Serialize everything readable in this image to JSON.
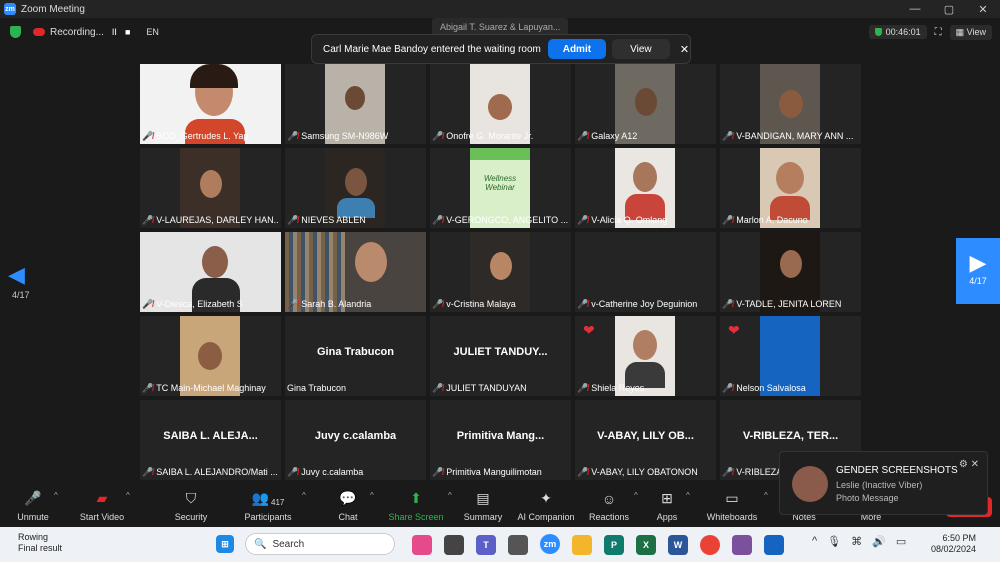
{
  "window": {
    "title": "Zoom Meeting",
    "controls": [
      "—",
      "▢",
      "✕"
    ]
  },
  "topbar": {
    "recording_label": "Recording...",
    "pause_glyph": "II",
    "stop_glyph": "■",
    "language": "EN",
    "timer": "00:46:01",
    "view_label": "View"
  },
  "ghost_name": "Abigail T. Suarez & Lapuyan...",
  "waiting_room": {
    "message": "Carl Marie Mae Bandoy entered the waiting room",
    "admit_label": "Admit",
    "view_label": "View",
    "close_glyph": "✕"
  },
  "tiles": [
    {
      "name": "BOD_Gertrudes L. Yap"
    },
    {
      "name": "Samsung SM-N986W"
    },
    {
      "name": "Onofre G. Morante Jr."
    },
    {
      "name": "Galaxy A12"
    },
    {
      "name": "V-BANDIGAN, MARY ANN ..."
    },
    {
      "name": "V-LAUREJAS, DARLEY HAN..."
    },
    {
      "name": "NIEVES ABLEN"
    },
    {
      "name": "V-GERONGCO, ANGELITO ..."
    },
    {
      "name": "V-Alicia Q. Omlang"
    },
    {
      "name": "Marlon A. Dacuno"
    },
    {
      "name": "V-Diesca, Elizabeth S"
    },
    {
      "name": "Sarah B. Alandria"
    },
    {
      "name": "v-Cristina Malaya"
    },
    {
      "name": "v-Catherine Joy Deguinion"
    },
    {
      "name": "V-TADLE, JENITA LOREN"
    },
    {
      "name": "TC Main-Michael Maghinay"
    },
    {
      "name": "Gina Trabucon",
      "big": "Gina Trabucon"
    },
    {
      "name": "JULIET TANDUYAN",
      "big": "JULIET TANDUY..."
    },
    {
      "name": "Shiela Reyes"
    },
    {
      "name": "Nelson Salvalosa"
    },
    {
      "name": "SAIBA L. ALEJANDRO/Mati ...",
      "big": "SAIBA L. ALEJA..."
    },
    {
      "name": "Juvy c.calamba",
      "big": "Juvy c.calamba"
    },
    {
      "name": "Primitiva Manguilimotan",
      "big": "Primitiva  Mang..."
    },
    {
      "name": "V-ABAY, LILY OBATONON",
      "big": "V-ABAY, LILY OB..."
    },
    {
      "name": "V-RIBLEZA, TER...",
      "big": "V-RIBLEZA, TER..."
    }
  ],
  "slide_text": "Wellness Webinar",
  "pager": {
    "left": "4/17",
    "right": "4/17"
  },
  "toast": {
    "title": "GENDER SCREENSHOTS",
    "sender": "Leslie (Inactive Viber)",
    "body": "Photo Message"
  },
  "toolbar": {
    "unmute": "Unmute",
    "start_video": "Start Video",
    "security": "Security",
    "participants": "Participants",
    "participants_count": "417",
    "chat": "Chat",
    "share_screen": "Share Screen",
    "summary": "Summary",
    "ai_companion": "AI Companion",
    "reactions": "Reactions",
    "apps": "Apps",
    "whiteboards": "Whiteboards",
    "notes": "Notes",
    "more": "More"
  },
  "taskbar": {
    "weather_title": "Rowing",
    "weather_sub": "Final result",
    "search_placeholder": "Search",
    "time": "6:50 PM",
    "date": "08/02/2024"
  }
}
